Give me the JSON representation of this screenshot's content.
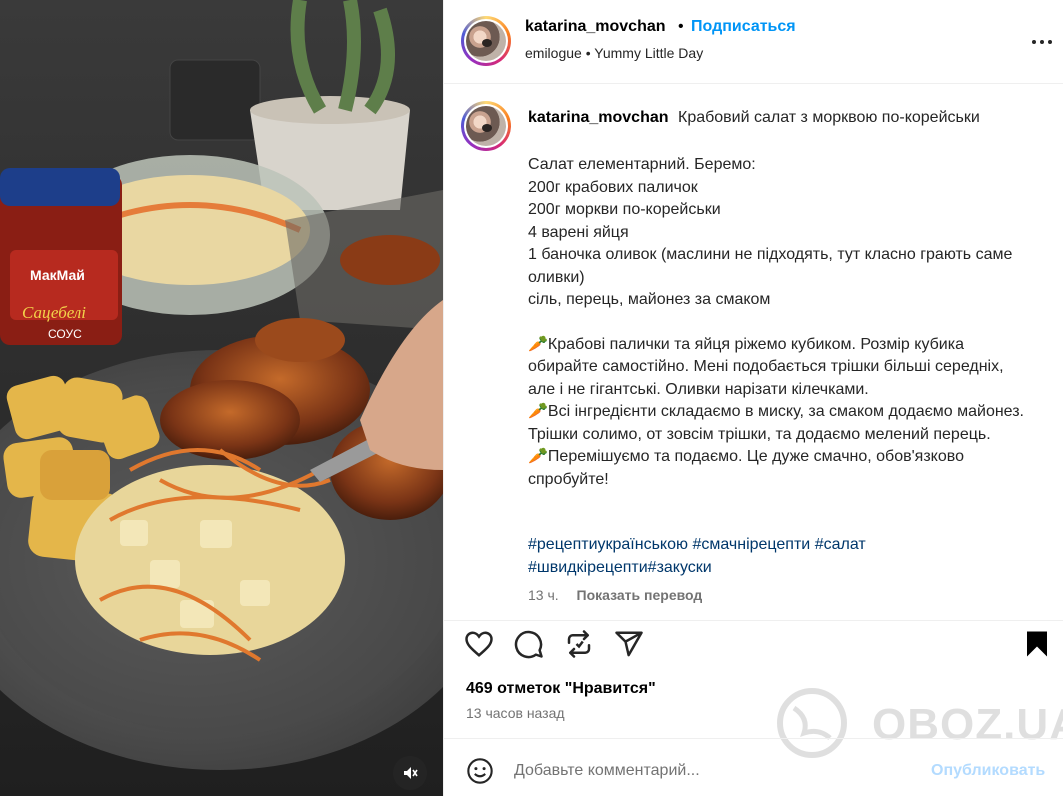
{
  "post": {
    "username": "katarina_movchan",
    "separator": "•",
    "follow_label": "Подписаться",
    "audio_artist": "emilogue",
    "audio_track": "Yummy Little Day",
    "more_label": "Другие действия"
  },
  "media": {
    "jar_brand": "МакМай",
    "jar_name": "Сацебелі",
    "jar_type": "СОУС"
  },
  "caption": {
    "username": "katarina_movchan",
    "title": "Крабовий салат з морквою по-корейськи",
    "intro_lines": "Салат елементарний. Беремо:\n200г крабових паличок\n200г моркви по-корейськи\n4 варені яйця\n1 баночка оливок (маслини не підходять, тут класно грають саме оливки)\nсіль, перець, майонез за смаком",
    "step1": "🥕Крабові палички та яйця ріжемо кубиком. Розмір кубика обирайте самостійно. Мені подобається трішки більші середніх, але і не гігантські. Оливки нарізати кілечками.",
    "step2": "🥕Всі інгредієнти складаємо в миску, за смаком додаємо майонез. Трішки солимо, от зовсім трішки, та додаємо мелений перець.",
    "step3": "🥕Перемішуємо та подаємо. Це дуже смачно, обов'язково спробуйте!",
    "hashtags": [
      "#рецептиукраїнською",
      "#смачнірецепти",
      "#салат",
      "#швидкірецепти",
      "#закуски"
    ],
    "time": "13 ч.",
    "translate_label": "Показать перевод"
  },
  "stats": {
    "likes": "469 отметок \"Нравится\"",
    "posted_ago": "13 часов назад"
  },
  "comment": {
    "placeholder": "Добавьте комментарий...",
    "publish_label": "Опубликовать"
  },
  "watermark": {
    "text": "OBOZ.UA"
  },
  "colors": {
    "link": "#0095f6",
    "hashtag": "#00376b",
    "muted": "#737373",
    "publish_disabled": "#b3dbff"
  }
}
